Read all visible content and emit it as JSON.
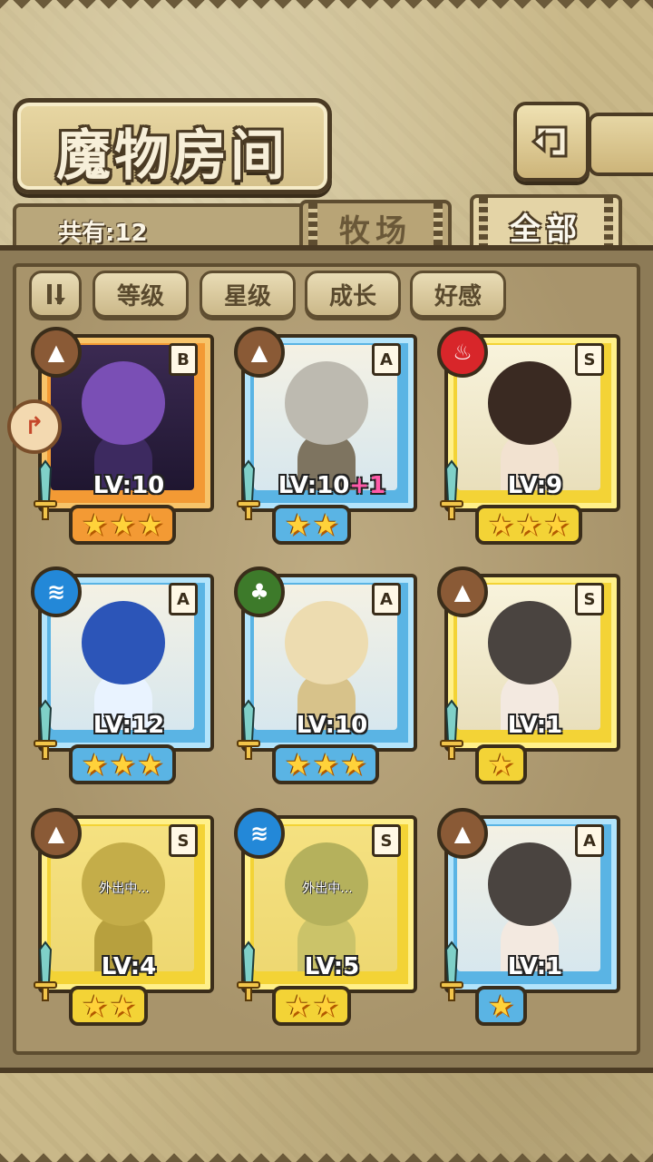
{
  "header": {
    "title": "魔物房间",
    "back_icon": "back-arrow-icon"
  },
  "count": {
    "label": "共有:12"
  },
  "tabs": [
    {
      "label": "牧场",
      "active": false
    },
    {
      "label": "全部",
      "active": true
    }
  ],
  "sort_buttons": [
    {
      "label": "等级"
    },
    {
      "label": "星级"
    },
    {
      "label": "成长"
    },
    {
      "label": "好感"
    }
  ],
  "sort_toggle_icon": "sort-order-icon",
  "monsters": [
    {
      "rank": "B",
      "element": "earth",
      "level": "LV:10",
      "bonus": "",
      "stars": 3,
      "frame": "orange",
      "away": false
    },
    {
      "rank": "A",
      "element": "earth",
      "level": "LV:10",
      "bonus": "+1",
      "stars": 2,
      "frame": "blue",
      "away": false
    },
    {
      "rank": "S",
      "element": "fire",
      "level": "LV:9",
      "bonus": "",
      "stars": 3,
      "frame": "yellow",
      "away": false
    },
    {
      "rank": "A",
      "element": "water",
      "level": "LV:12",
      "bonus": "",
      "stars": 3,
      "frame": "blue",
      "away": false
    },
    {
      "rank": "A",
      "element": "wood",
      "level": "LV:10",
      "bonus": "",
      "stars": 3,
      "frame": "blue",
      "away": false
    },
    {
      "rank": "S",
      "element": "earth",
      "level": "LV:1",
      "bonus": "",
      "stars": 1,
      "frame": "yellow",
      "away": false
    },
    {
      "rank": "S",
      "element": "earth",
      "level": "LV:4",
      "bonus": "",
      "stars": 2,
      "frame": "yellow",
      "away": true,
      "away_label": "外出中..."
    },
    {
      "rank": "S",
      "element": "water",
      "level": "LV:5",
      "bonus": "",
      "stars": 2,
      "frame": "yellow",
      "away": true,
      "away_label": "外出中..."
    },
    {
      "rank": "A",
      "element": "earth",
      "level": "LV:1",
      "bonus": "",
      "stars": 1,
      "frame": "blue",
      "away": false
    }
  ],
  "colors": {
    "earth": "#8a5a36",
    "fire": "#d8262a",
    "water": "#2388d8",
    "wood": "#3d7a2a"
  }
}
